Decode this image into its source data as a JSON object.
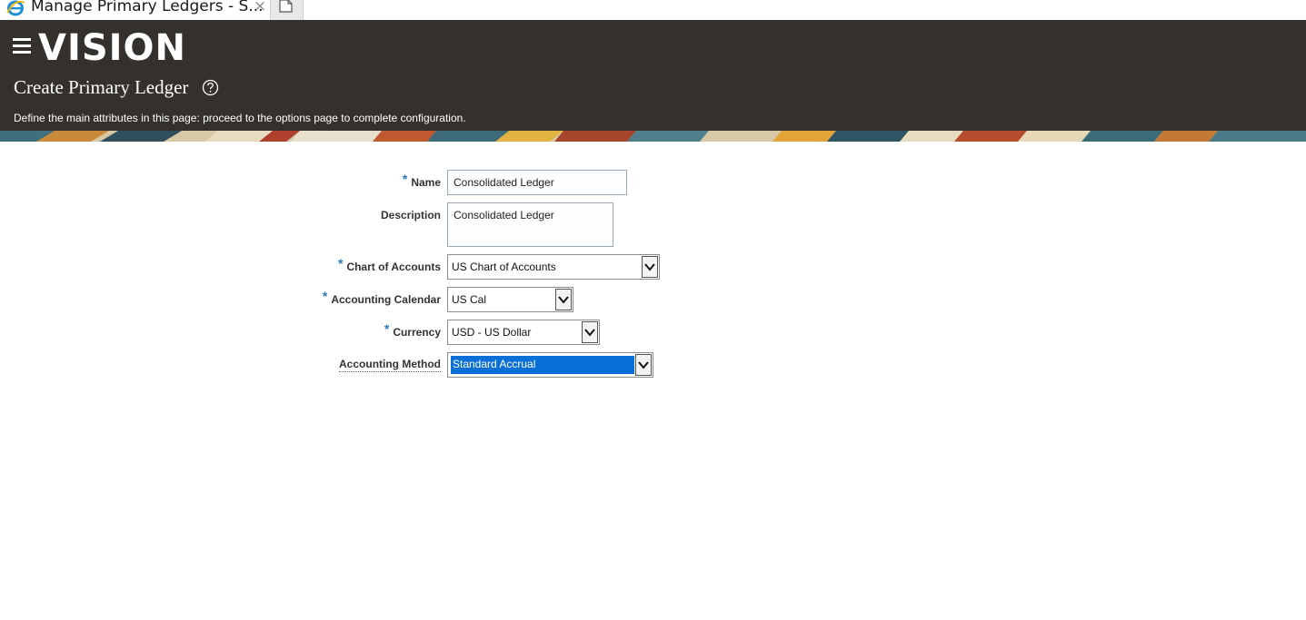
{
  "browser": {
    "tab_title": "Manage Primary Ledgers - S...",
    "close_glyph": "×",
    "favicon": "ie-icon",
    "new_tab_icon": "new-tab-icon"
  },
  "header": {
    "menu_icon": "hamburger-icon",
    "logo_text": "VISION",
    "page_title": "Create Primary Ledger",
    "help_icon": "help-icon",
    "instructions": "Define the main attributes in this page: proceed to the options page to complete configuration.",
    "background_color": "#34302c"
  },
  "form": {
    "required_marker": "*",
    "name": {
      "label": "Name",
      "required": true,
      "value": "Consolidated Ledger"
    },
    "description": {
      "label": "Description",
      "required": false,
      "value": "Consolidated Ledger"
    },
    "chart_of_accounts": {
      "label": "Chart of Accounts",
      "required": true,
      "value": "US Chart of Accounts"
    },
    "accounting_calendar": {
      "label": "Accounting Calendar",
      "required": true,
      "value": "US Cal"
    },
    "currency": {
      "label": "Currency",
      "required": true,
      "value": "USD - US Dollar"
    },
    "accounting_method": {
      "label": "Accounting Method",
      "required": false,
      "value": "Standard Accrual",
      "selected_highlight_color": "#0a6fd6"
    }
  },
  "colors": {
    "required_star": "#2b78b8"
  }
}
